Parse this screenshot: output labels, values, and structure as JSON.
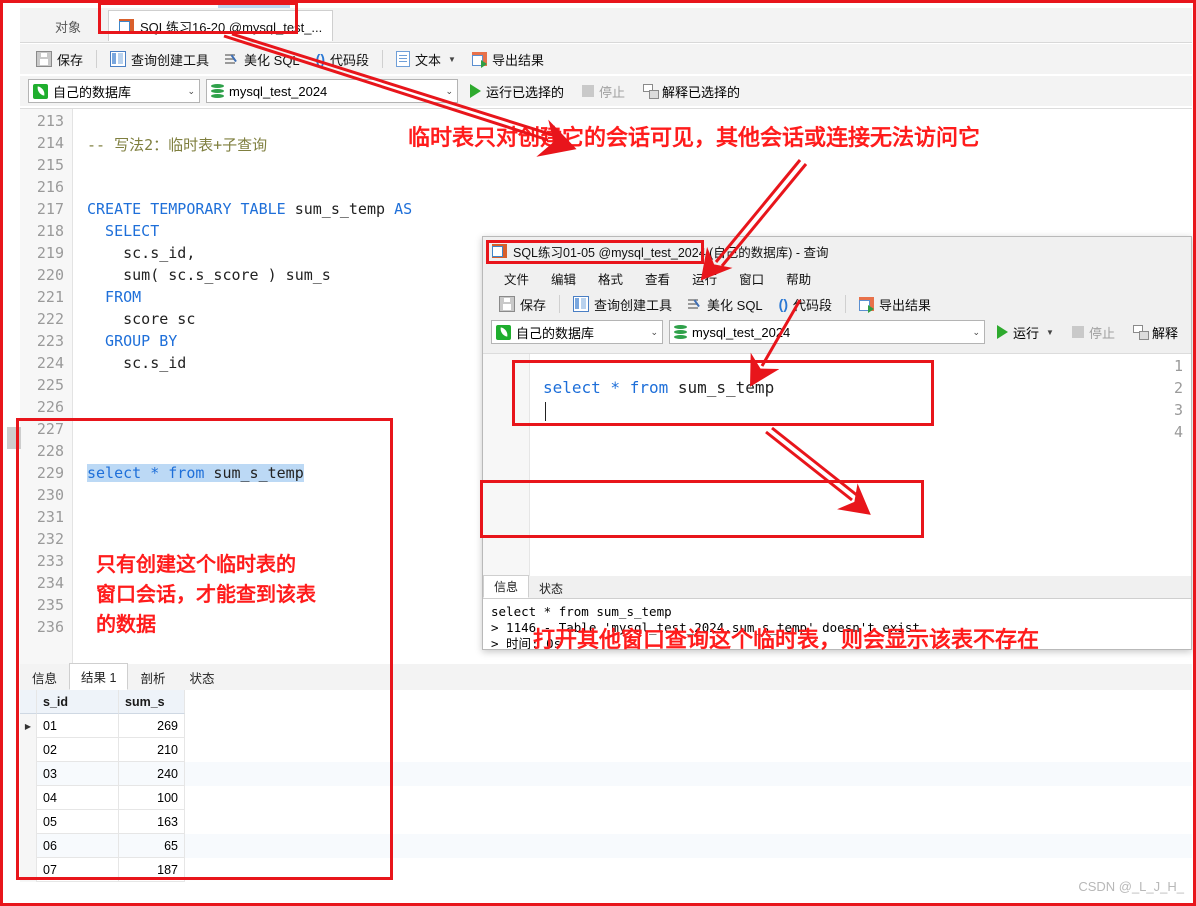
{
  "main_window": {
    "tabs": {
      "objects_label": "对象",
      "doc_tab_label": "SQL练习16-20 @mysql_test_...",
      "doc_tab_icon": "table-icon"
    },
    "toolbar": [
      {
        "label": "保存",
        "icon": "save-icon"
      },
      {
        "label": "查询创建工具",
        "icon": "query-builder-icon"
      },
      {
        "label": "美化 SQL",
        "icon": "beautify-icon"
      },
      {
        "label": "代码段",
        "icon": "code-snippet-icon"
      },
      {
        "label": "文本",
        "icon": "text-icon",
        "has_caret": true
      },
      {
        "label": "导出结果",
        "icon": "export-icon"
      }
    ],
    "connection_bar": {
      "connection": "自己的数据库",
      "connection_icon": "leaf-icon",
      "database": "mysql_test_2024",
      "database_icon": "database-icon",
      "run_label": "运行已选择的",
      "stop_label": "停止",
      "explain_label": "解释已选择的"
    },
    "editor": {
      "lines": [
        {
          "no": "213",
          "text": "",
          "type": "plain"
        },
        {
          "no": "214",
          "text": "-- 写法2：临时表+子查询",
          "type": "comment"
        },
        {
          "no": "215",
          "text": "",
          "type": "plain"
        },
        {
          "no": "216",
          "text": "",
          "type": "plain"
        },
        {
          "no": "217",
          "text": "CREATE TEMPORARY TABLE sum_s_temp AS",
          "type": "sql"
        },
        {
          "no": "218",
          "text": "  SELECT",
          "type": "sql"
        },
        {
          "no": "219",
          "text": "    sc.s_id,",
          "type": "sql"
        },
        {
          "no": "220",
          "text": "    sum( sc.s_score ) sum_s",
          "type": "sql"
        },
        {
          "no": "221",
          "text": "  FROM",
          "type": "sql"
        },
        {
          "no": "222",
          "text": "    score sc",
          "type": "sql"
        },
        {
          "no": "223",
          "text": "  GROUP BY",
          "type": "sql"
        },
        {
          "no": "224",
          "text": "    sc.s_id",
          "type": "sql"
        },
        {
          "no": "225",
          "text": "",
          "type": "plain"
        },
        {
          "no": "226",
          "text": "",
          "type": "plain"
        },
        {
          "no": "227",
          "text": "",
          "type": "plain"
        },
        {
          "no": "228",
          "text": "select * from sum_s_temp",
          "type": "selected"
        },
        {
          "no": "229",
          "text": "",
          "type": "plain"
        },
        {
          "no": "230",
          "text": "",
          "type": "plain"
        },
        {
          "no": "231",
          "text": "",
          "type": "plain"
        },
        {
          "no": "232",
          "text": "",
          "type": "plain"
        },
        {
          "no": "233",
          "text": "",
          "type": "plain"
        },
        {
          "no": "234",
          "text": "",
          "type": "plain"
        },
        {
          "no": "235",
          "text": "",
          "type": "plain"
        },
        {
          "no": "236",
          "text": "",
          "type": "plain"
        }
      ]
    },
    "result_tabs": [
      {
        "label": "信息",
        "selected": false
      },
      {
        "label": "结果 1",
        "selected": true
      },
      {
        "label": "剖析",
        "selected": false
      },
      {
        "label": "状态",
        "selected": false
      }
    ],
    "result_grid": {
      "columns": [
        "s_id",
        "sum_s"
      ],
      "rows": [
        [
          "01",
          "269"
        ],
        [
          "02",
          "210"
        ],
        [
          "03",
          "240"
        ],
        [
          "04",
          "100"
        ],
        [
          "05",
          "163"
        ],
        [
          "06",
          "65"
        ],
        [
          "07",
          "187"
        ]
      ],
      "current_row_index": 0
    }
  },
  "sub_window": {
    "title": "SQL练习01-05 @mysql_test_2024 (自己的数据库) - 查询",
    "title_icon": "table-icon",
    "menus": [
      "文件",
      "编辑",
      "格式",
      "查看",
      "运行",
      "窗口",
      "帮助"
    ],
    "toolbar": [
      {
        "label": "保存",
        "icon": "save-icon"
      },
      {
        "label": "查询创建工具",
        "icon": "query-builder-icon"
      },
      {
        "label": "美化 SQL",
        "icon": "beautify-icon"
      },
      {
        "label": "代码段",
        "icon": "code-snippet-icon"
      },
      {
        "label": "导出结果",
        "icon": "export-icon"
      }
    ],
    "connection_bar": {
      "connection": "自己的数据库",
      "connection_icon": "leaf-icon",
      "database": "mysql_test_2024",
      "database_icon": "database-icon",
      "run_label": "运行",
      "stop_label": "停止",
      "explain_label": "解释"
    },
    "editor": {
      "lines": [
        {
          "no": "1",
          "text": "",
          "type": "plain"
        },
        {
          "no": "2",
          "text": "select * from sum_s_temp",
          "type": "sql"
        },
        {
          "no": "3",
          "text": "",
          "type": "plain"
        },
        {
          "no": "4",
          "text": "",
          "type": "plain"
        }
      ]
    },
    "info_tabs": [
      {
        "label": "信息",
        "selected": true
      },
      {
        "label": "状态",
        "selected": false
      }
    ],
    "message": "select * from sum_s_temp\n> 1146 - Table 'mysql_test_2024.sum_s_temp' doesn't exist\n> 时间: 0s"
  },
  "annotations": {
    "top_note": "临时表只对创建它的会话可见，其他会话或连接无法访问它",
    "left_note_line1": "只有创建这个临时表的",
    "left_note_line2": "窗口会话，才能查到该表",
    "left_note_line3": "的数据",
    "bottom_note": "打开其他窗口查询这个临时表，则会显示该表不存在",
    "accent_color": "#ff1c1c"
  },
  "watermark": "CSDN @_L_J_H_"
}
